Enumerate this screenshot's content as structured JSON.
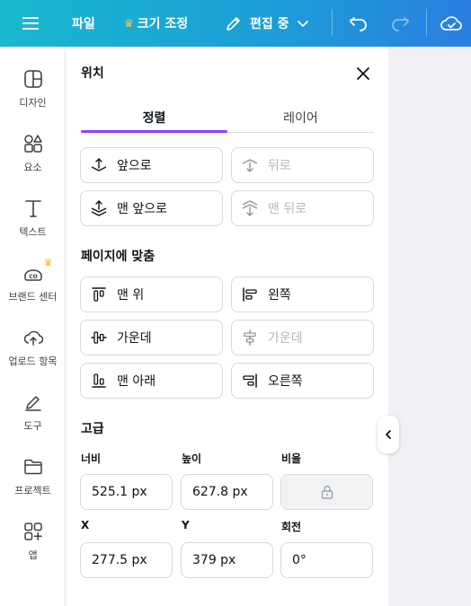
{
  "topbar": {
    "file_label": "파일",
    "resize_label": "크기 조정",
    "edit_label": "편집 중"
  },
  "rail": [
    {
      "label": "디자인",
      "icon": "design-icon"
    },
    {
      "label": "요소",
      "icon": "elements-icon"
    },
    {
      "label": "텍스트",
      "icon": "text-icon"
    },
    {
      "label": "브랜드 센터",
      "icon": "brand-icon"
    },
    {
      "label": "업로드 항목",
      "icon": "upload-icon"
    },
    {
      "label": "도구",
      "icon": "tools-icon"
    },
    {
      "label": "프로젝트",
      "icon": "folder-icon"
    },
    {
      "label": "앱",
      "icon": "apps-icon"
    }
  ],
  "panel": {
    "title": "위치",
    "tabs": [
      "정렬",
      "레이어"
    ],
    "layer_buttons": {
      "forward": "앞으로",
      "backward": "뒤로",
      "to_front": "맨 앞으로",
      "to_back": "맨 뒤로"
    },
    "align_section": "페이지에 맞춤",
    "align_buttons": {
      "top": "맨 위",
      "left": "왼쪽",
      "middle": "가운데",
      "center": "가운데",
      "bottom": "맨 아래",
      "right": "오른쪽"
    },
    "advanced_section": "고급",
    "fields": {
      "width_label": "너비",
      "width_value": "525.1 px",
      "height_label": "높이",
      "height_value": "627.8 px",
      "ratio_label": "비율",
      "x_label": "X",
      "x_value": "277.5 px",
      "y_label": "Y",
      "y_value": "379 px",
      "rotation_label": "회전",
      "rotation_value": "0°"
    }
  },
  "colors": {
    "accent": "#8b3dff",
    "topbar_start": "#1ab8cf",
    "topbar_end": "#2a7fe0",
    "crown": "#f2b322"
  }
}
